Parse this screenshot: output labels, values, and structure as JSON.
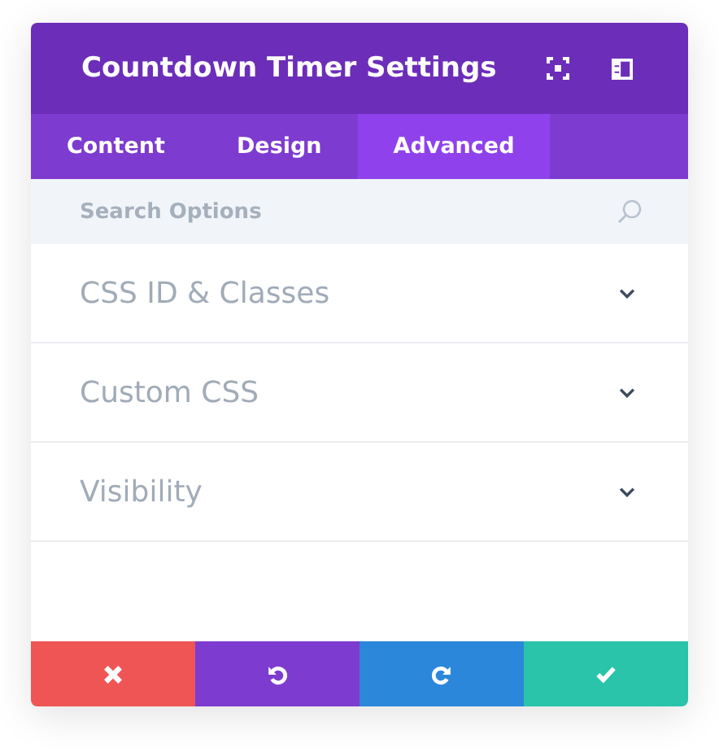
{
  "window": {
    "title": "Countdown Timer Settings"
  },
  "tabs": [
    {
      "label": "Content",
      "selected": false
    },
    {
      "label": "Design",
      "selected": false
    },
    {
      "label": "Advanced",
      "selected": true
    }
  ],
  "search": {
    "placeholder": "Search Options"
  },
  "sections": [
    {
      "label": "CSS ID & Classes",
      "expanded": false
    },
    {
      "label": "Custom CSS",
      "expanded": false
    },
    {
      "label": "Visibility",
      "expanded": false
    }
  ],
  "actions": [
    {
      "kind": "cancel"
    },
    {
      "kind": "undo"
    },
    {
      "kind": "redo"
    },
    {
      "kind": "save"
    }
  ]
}
